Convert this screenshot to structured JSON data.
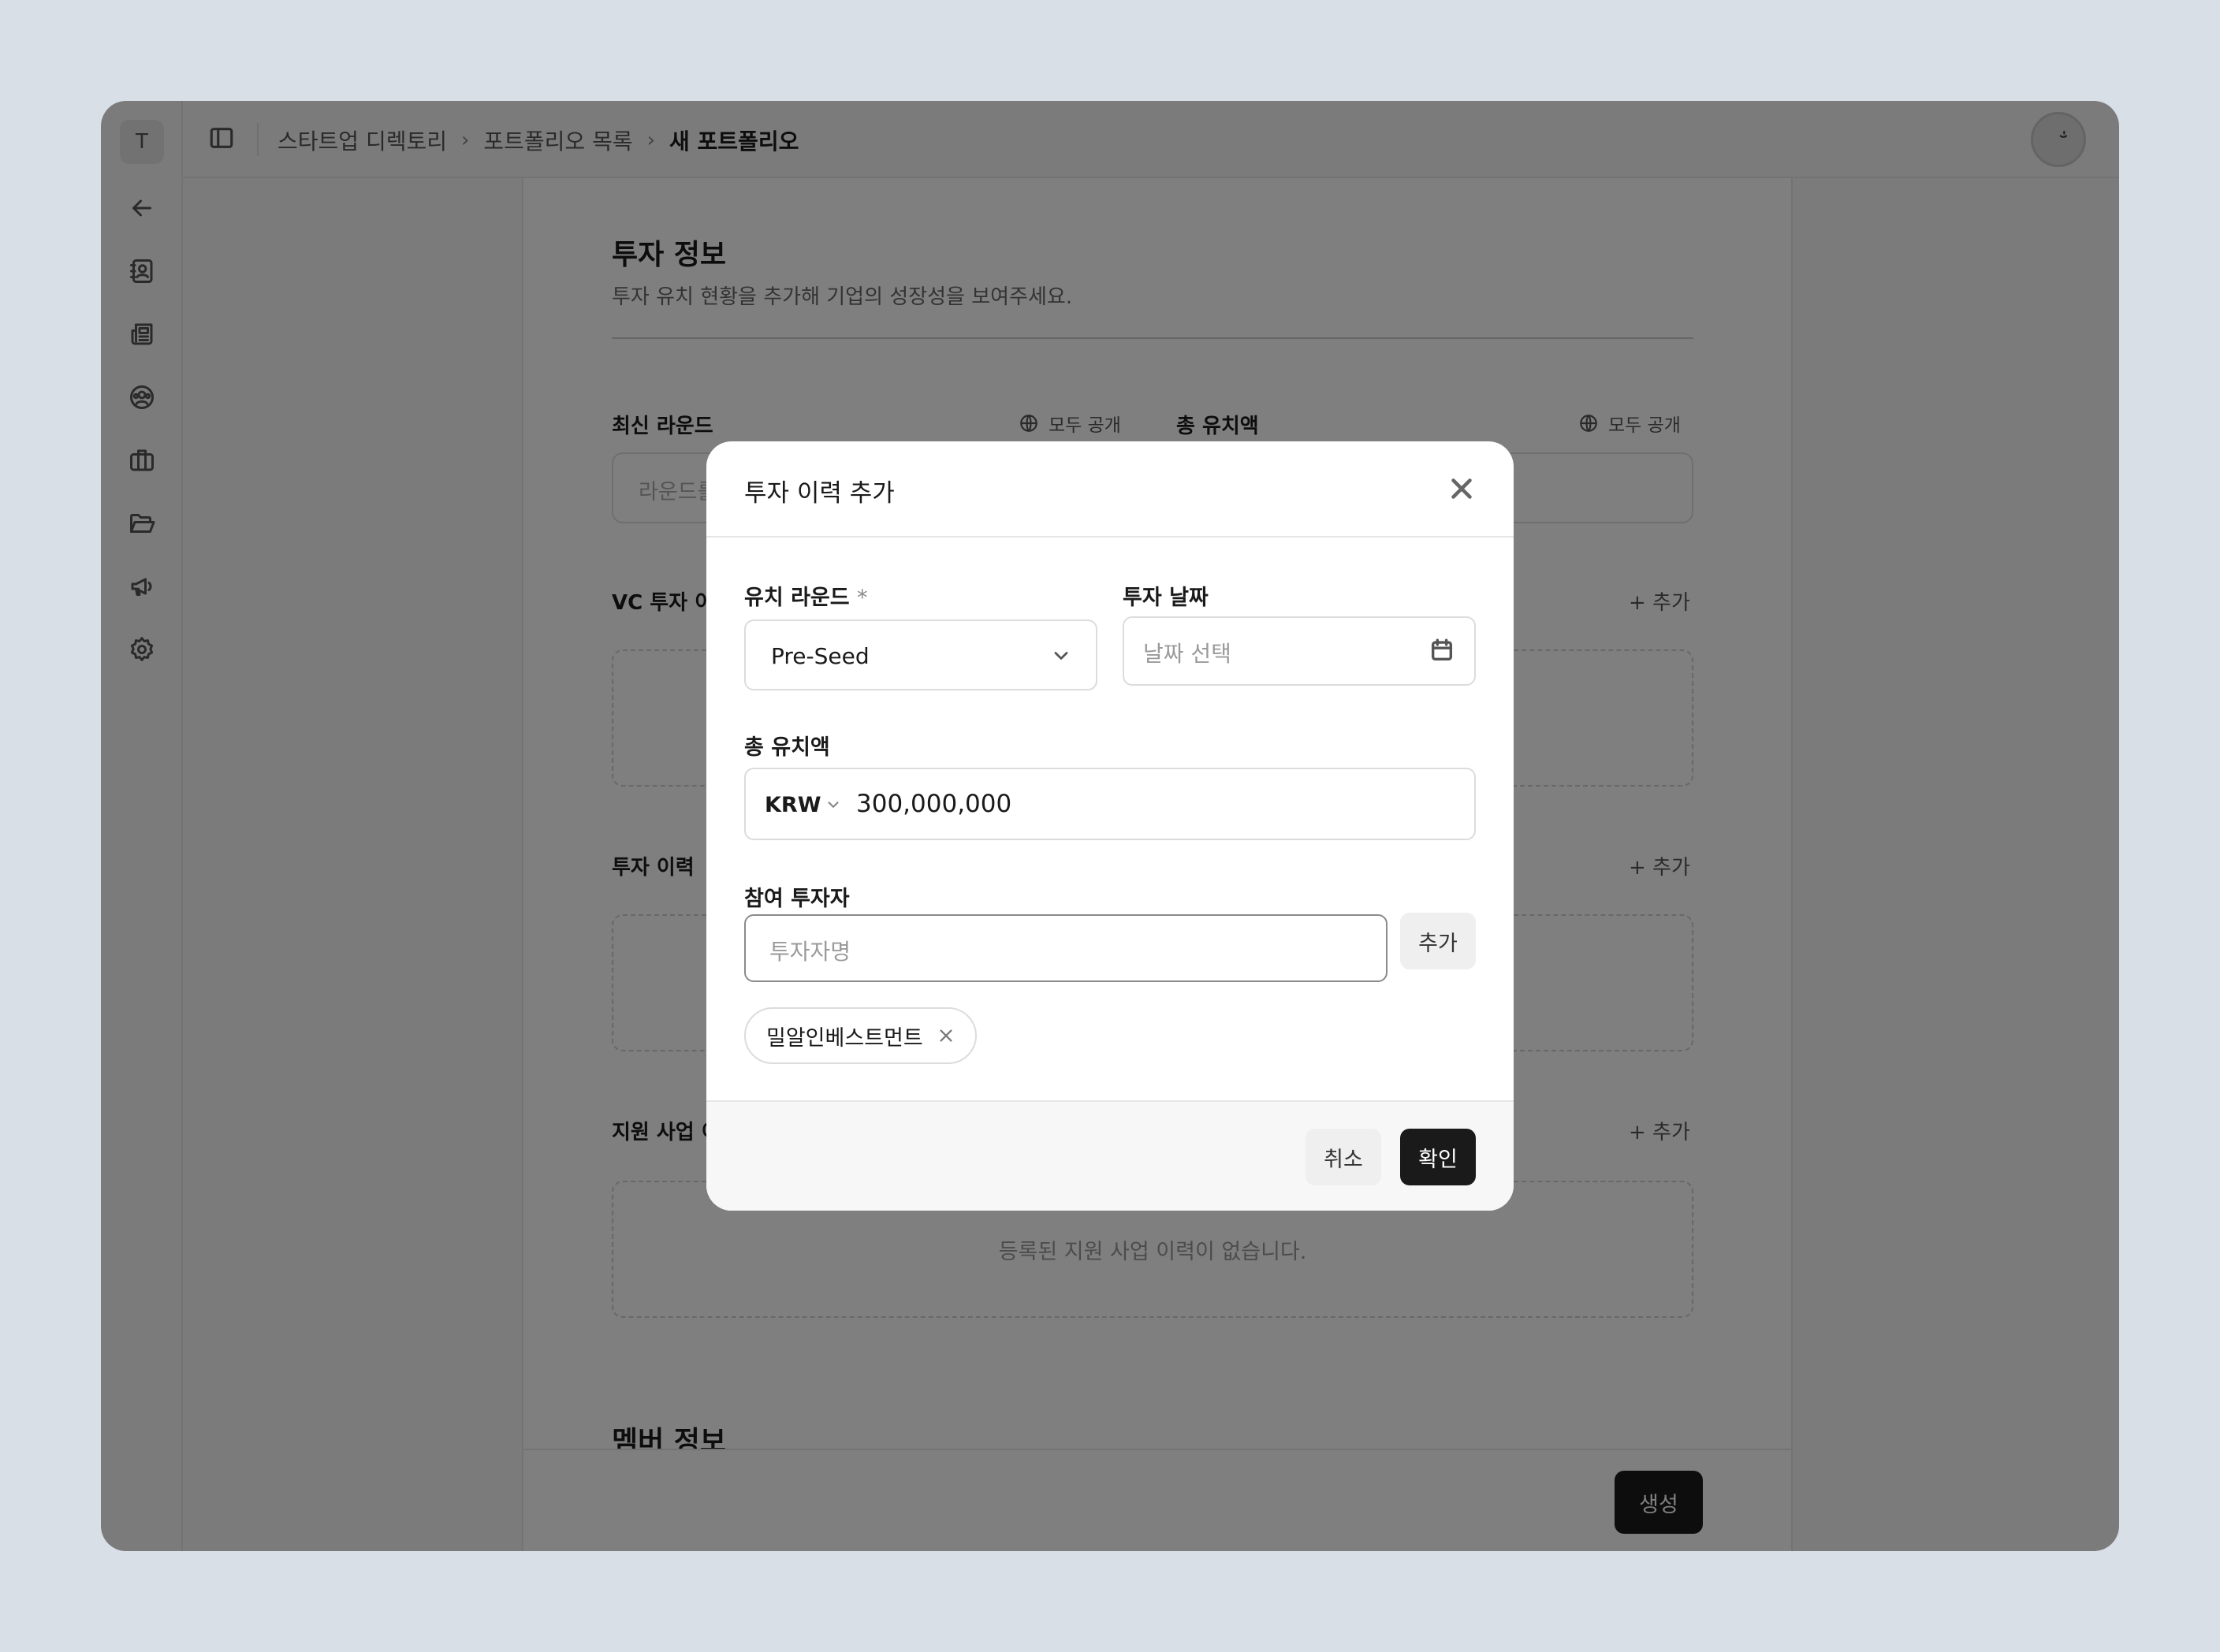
{
  "sidebar": {
    "logo_letter": "T",
    "icons": [
      "arrow-left-icon",
      "contacts-icon",
      "news-icon",
      "community-icon",
      "briefcase-icon",
      "folder-icon",
      "megaphone-icon",
      "settings-icon"
    ]
  },
  "topbar": {
    "breadcrumbs": [
      "스타트업 디렉토리",
      "포트폴리오 목록",
      "새 포트폴리오"
    ]
  },
  "page": {
    "section_title": "투자 정보",
    "section_subtitle": "투자 유치 현황을 추가해 기업의 성장성을 보여주세요.",
    "latest_round_label": "최신 라운드",
    "latest_round_placeholder": "라운드를",
    "public_label": "모두 공개",
    "total_label": "총 유치액",
    "vc_label": "VC 투자 이",
    "history_label": "투자 이력",
    "support_label": "지원 사업 이",
    "add_label": "+ 추가",
    "support_empty": "등록된 지원 사업 이력이 없습니다.",
    "member_title": "멤버 정보",
    "create_button": "생성"
  },
  "modal": {
    "title": "투자 이력 추가",
    "round_label": "유치 라운드",
    "required_mark": "*",
    "round_value": "Pre-Seed",
    "date_label": "투자 날짜",
    "date_placeholder": "날짜 선택",
    "amount_label": "총 유치액",
    "currency": "KRW",
    "amount_value": "300,000,000",
    "investor_label": "참여 투자자",
    "investor_placeholder": "투자자명",
    "add_button": "추가",
    "chips": [
      "밀알인베스트먼트"
    ],
    "cancel_button": "취소",
    "confirm_button": "확인"
  }
}
